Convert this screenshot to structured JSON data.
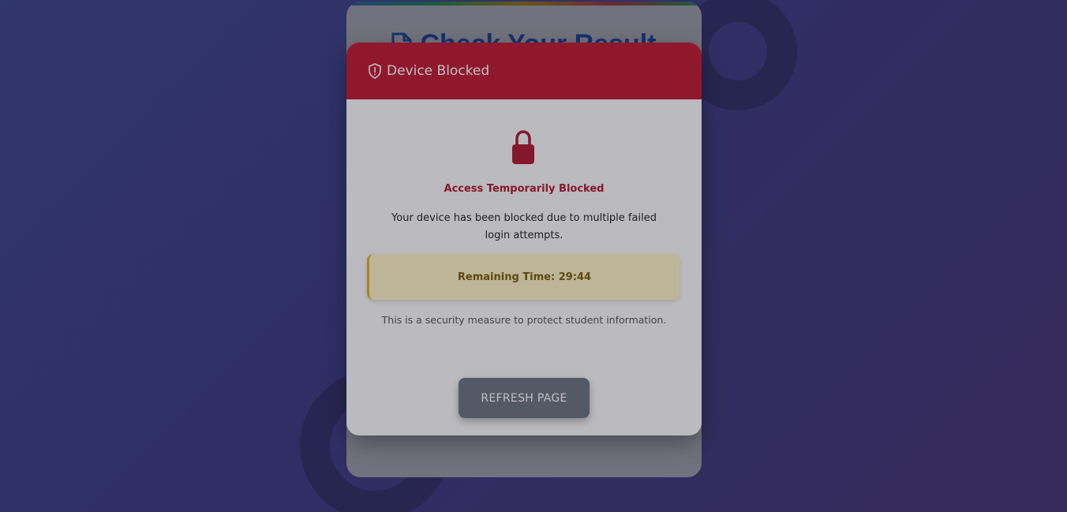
{
  "page": {
    "title": "Check Your Result",
    "doc_icon": "document-icon"
  },
  "modal": {
    "title": "Device Blocked",
    "header_icon": "shield-alert-icon",
    "lock_icon": "lock-icon",
    "heading": "Access Temporarily Blocked",
    "message": "Your device has been blocked due to multiple failed login attempts.",
    "timer": "Remaining Time: 29:44",
    "note": "This is a security measure to protect student information.",
    "refresh_label": "REFRESH PAGE"
  },
  "colors": {
    "header": "#c01a2e",
    "heading": "#b0182c",
    "timer_bg": "#fdf3c4",
    "button": "#6c757d"
  }
}
